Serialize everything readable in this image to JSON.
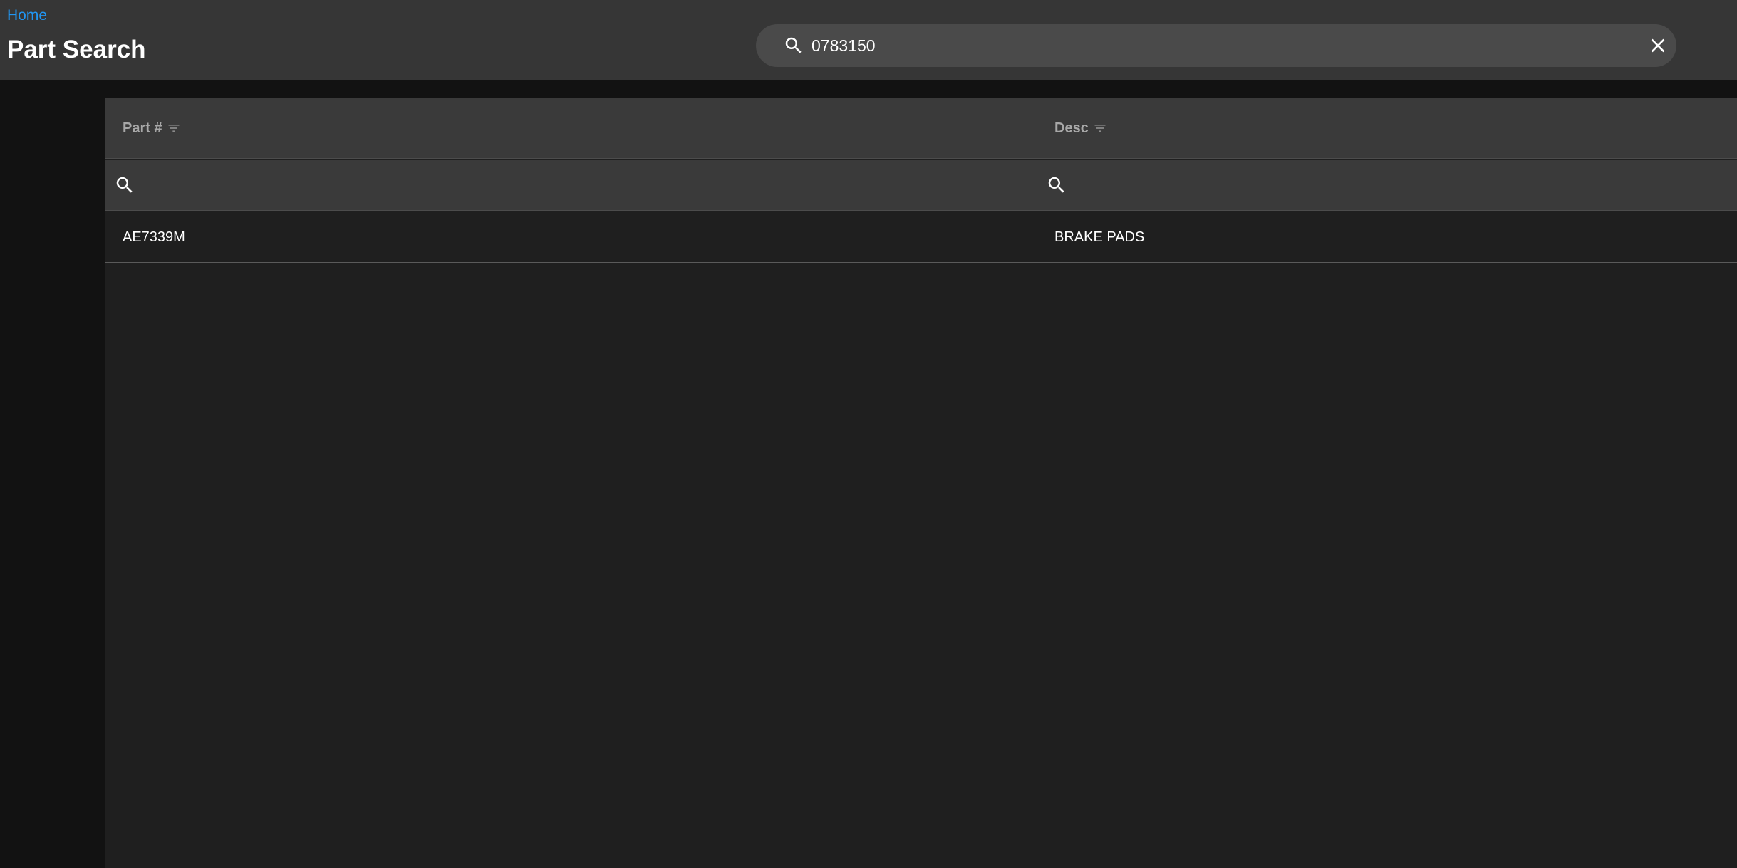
{
  "header": {
    "breadcrumb": "Home",
    "title": "Part Search"
  },
  "search": {
    "value": "0783150",
    "icon": "search-icon",
    "clear_icon": "close-icon"
  },
  "grid": {
    "columns": [
      {
        "label": "Part #"
      },
      {
        "label": "Desc"
      }
    ],
    "rows": [
      {
        "part": "AE7339M",
        "desc": "BRAKE PADS"
      }
    ]
  },
  "colors": {
    "accent": "#2196f3",
    "header_bg": "#363636",
    "grid_header_bg": "#3a3a3a",
    "grid_bg": "#1f1f1f",
    "page_bg": "#121212"
  }
}
